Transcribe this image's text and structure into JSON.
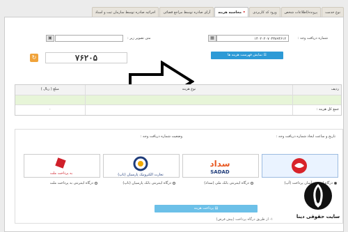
{
  "tabs": [
    {
      "label": "نوع خدمت",
      "active": false
    },
    {
      "label": "پرونده/اطلاعات شخص",
      "active": false
    },
    {
      "label": "ورود کد کاربردی",
      "active": false
    },
    {
      "label": "محاسبه هزینه",
      "active": true
    },
    {
      "label": "آزای صادره توسط مراجع قضائی",
      "active": false
    },
    {
      "label": "اجرائیه صادره توسط سازمان ثبت و اسناد",
      "active": false
    }
  ],
  "form": {
    "receipt_label": "شماره دریافت وجه :",
    "receipt_value": "۱۴۰۲۰۲۰۷۰۴۳۸۹۴۶۱۲",
    "image_label": "متن تصویر زیر :",
    "image_value": "",
    "captcha_text": "۷۶۲۰۵",
    "show_fees_button": "نمایش فهرست هزینه ها"
  },
  "fee_table": {
    "headers": [
      "ردیف",
      "نوع هزینه",
      "مبلغ ( ریال )"
    ],
    "total_label": "جمع کل هزینه :",
    "total_value": "۰"
  },
  "payment": {
    "datetime_label": "تاریخ و ساعت ایجاد شماره دریافت وجه :",
    "status_label": "وضعیت شماره دریافت وجه :",
    "gateways": [
      {
        "logo_text": "آسان پرداخت",
        "option": "درگاه اینترنتی آسان پرداخت (آپ)",
        "selected": true,
        "color": "#d8232a"
      },
      {
        "logo_text": "سداد SADAD",
        "option": "درگاه اینترنتی بانک ملی (سداد)",
        "selected": false,
        "color": "#e85a24"
      },
      {
        "logo_text": "تجارت الکترونیک پارسیان (تاپ)",
        "option": "درگاه اینترنتی بانک پارسیان (تاپ)",
        "selected": false,
        "color": "#1f3c7a"
      },
      {
        "logo_text": "به پرداخت ملت",
        "option": "درگاه اینترنتی به پرداخت ملت",
        "selected": false,
        "color": "#d0202a"
      }
    ],
    "pay_button": "پرداخت هزینه",
    "footnote": "۱- از طریق درگاه پرداخت (پیش فرض)"
  },
  "watermark": {
    "text": "سایت حقوقی دینا"
  }
}
